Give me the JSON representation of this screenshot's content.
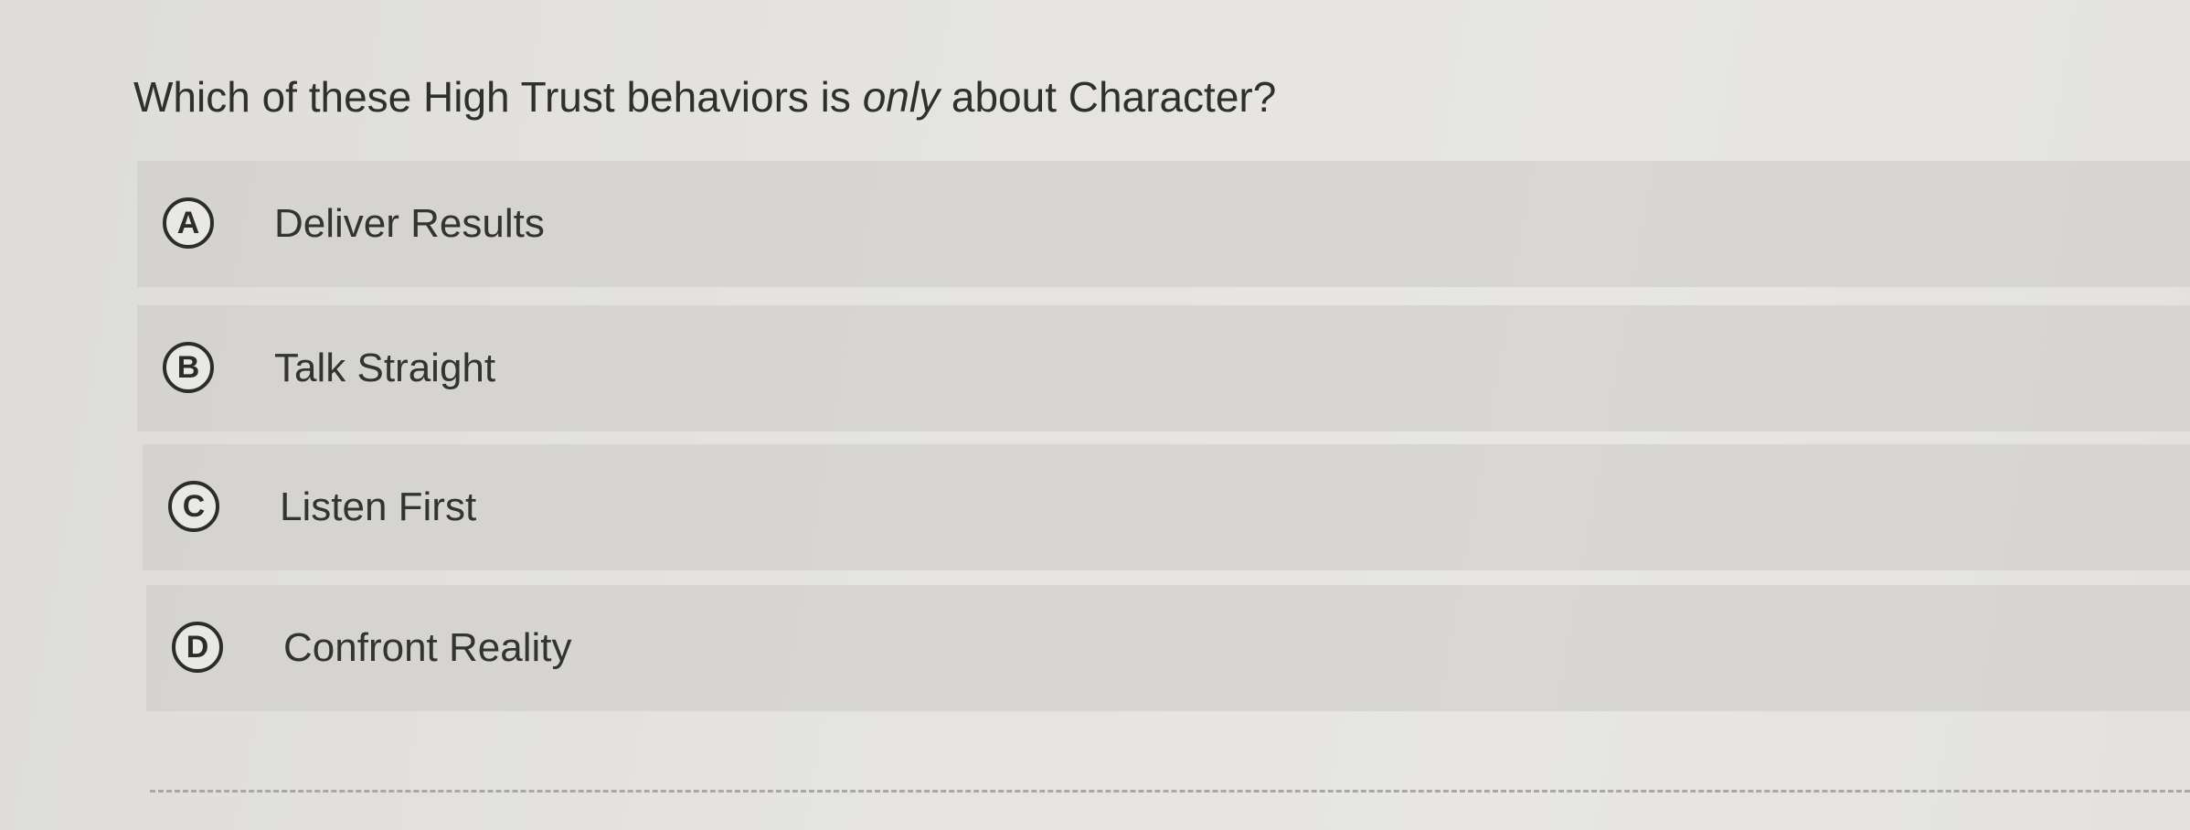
{
  "question": {
    "prefix": "Which of these High Trust behaviors is ",
    "emphasis": "only",
    "suffix": " about Character?"
  },
  "options": [
    {
      "letter": "A",
      "label": "Deliver Results"
    },
    {
      "letter": "B",
      "label": "Talk Straight"
    },
    {
      "letter": "C",
      "label": "Listen First"
    },
    {
      "letter": "D",
      "label": "Confront Reality"
    }
  ],
  "colors": {
    "background": "#e4e3df",
    "option_background": "#d6d5d1",
    "text": "#2f2f2f"
  }
}
